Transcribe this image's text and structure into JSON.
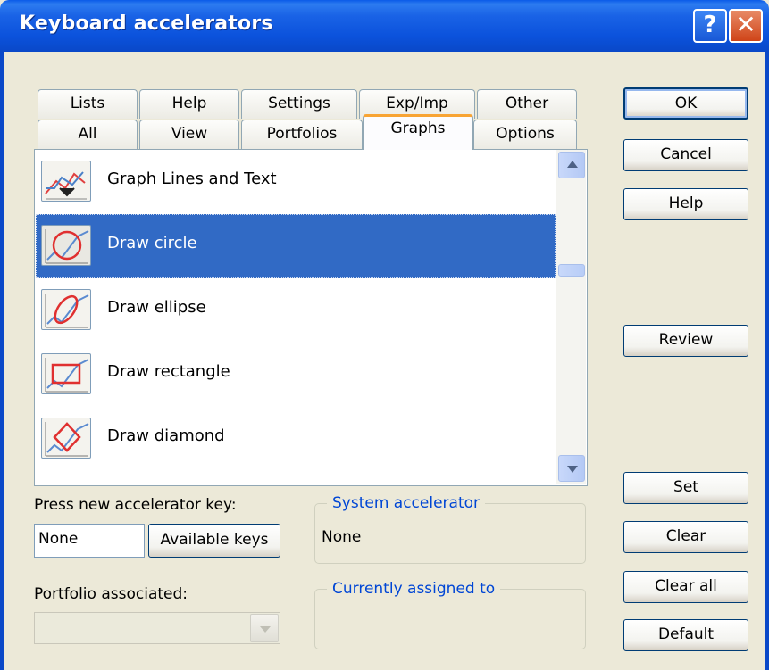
{
  "window": {
    "title": "Keyboard accelerators"
  },
  "titlebar": {
    "help_glyph": "?",
    "close_glyph": "✕"
  },
  "tabs_back": [
    "Lists",
    "Help",
    "Settings",
    "Exp/Imp",
    "Other"
  ],
  "tabs_front": [
    "All",
    "View",
    "Portfolios",
    "Graphs",
    "Options"
  ],
  "active_tab": "Graphs",
  "list": {
    "items": [
      {
        "label": "Graph Lines and Text",
        "icon": "graph-lines-text-icon",
        "selected": false
      },
      {
        "label": "Draw circle",
        "icon": "draw-circle-icon",
        "selected": true
      },
      {
        "label": "Draw ellipse",
        "icon": "draw-ellipse-icon",
        "selected": false
      },
      {
        "label": "Draw rectangle",
        "icon": "draw-rectangle-icon",
        "selected": false
      },
      {
        "label": "Draw diamond",
        "icon": "draw-diamond-icon",
        "selected": false
      }
    ]
  },
  "buttons": {
    "ok": "OK",
    "cancel": "Cancel",
    "help": "Help",
    "review": "Review",
    "set": "Set",
    "clear": "Clear",
    "clear_all": "Clear all",
    "default": "Default",
    "available_keys": "Available keys"
  },
  "labels": {
    "press_new_key": "Press new accelerator key:",
    "portfolio_associated": "Portfolio associated:",
    "system_accelerator": "System accelerator",
    "currently_assigned": "Currently assigned to"
  },
  "fields": {
    "new_key_value": "None",
    "system_accelerator_value": "None"
  },
  "colors": {
    "titlebar": "#0a52dc",
    "selection": "#316ac5",
    "group_legend": "#0046d5",
    "active_tab_accent": "#f8a434"
  }
}
